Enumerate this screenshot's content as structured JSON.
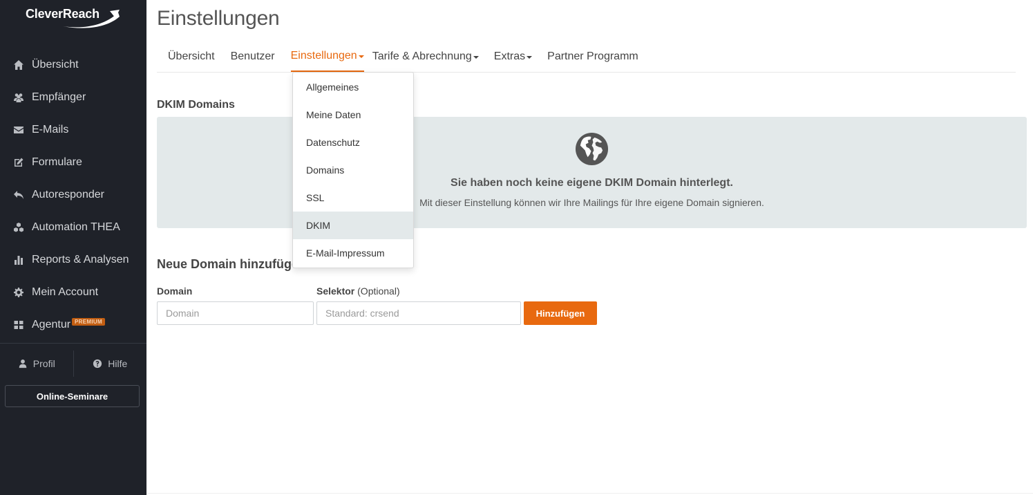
{
  "brand": {
    "name": "CleverReach",
    "accent": "#e8690f",
    "sidebar_bg": "#1f2229"
  },
  "sidebar": {
    "items": [
      {
        "label": "Übersicht",
        "icon": "home-icon"
      },
      {
        "label": "Empfänger",
        "icon": "users-icon"
      },
      {
        "label": "E-Mails",
        "icon": "envelope-icon"
      },
      {
        "label": "Formulare",
        "icon": "edit-icon"
      },
      {
        "label": "Autoresponder",
        "icon": "reply-icon"
      },
      {
        "label": "Automation THEA",
        "icon": "cubes-icon"
      },
      {
        "label": "Reports & Analysen",
        "icon": "bar-chart-icon"
      },
      {
        "label": "Mein Account",
        "icon": "gear-icon"
      },
      {
        "label": "Agentur",
        "icon": "grid-icon",
        "badge": "PREMIUM"
      }
    ],
    "profile_label": "Profil",
    "help_label": "Hilfe",
    "seminar_label": "Online-Seminare"
  },
  "page": {
    "title": "Einstellungen"
  },
  "tabs": [
    {
      "label": "Übersicht",
      "dropdown": false
    },
    {
      "label": "Benutzer",
      "dropdown": false
    },
    {
      "label": "Einstellungen",
      "dropdown": true,
      "active": true
    },
    {
      "label": "Tarife & Abrechnung",
      "dropdown": true
    },
    {
      "label": "Extras",
      "dropdown": true
    },
    {
      "label": "Partner Programm",
      "dropdown": false
    }
  ],
  "dropdown": {
    "items": [
      "Allgemeines",
      "Meine Daten",
      "Datenschutz",
      "Domains",
      "SSL",
      "DKIM",
      "E-Mail-Impressum"
    ],
    "highlighted": "DKIM"
  },
  "dkim": {
    "heading": "DKIM Domains",
    "empty_title": "Sie haben noch keine eigene DKIM Domain hinterlegt.",
    "empty_sub": "Mit dieser Einstellung können wir Ihre Mailings für Ihre eigene Domain signieren."
  },
  "new_domain": {
    "heading": "Neue Domain hinzufügen",
    "domain_label": "Domain",
    "domain_placeholder": "Domain",
    "selector_label": "Selektor",
    "selector_optional": "(Optional)",
    "selector_placeholder": "Standard: crsend",
    "submit_label": "Hinzufügen"
  }
}
